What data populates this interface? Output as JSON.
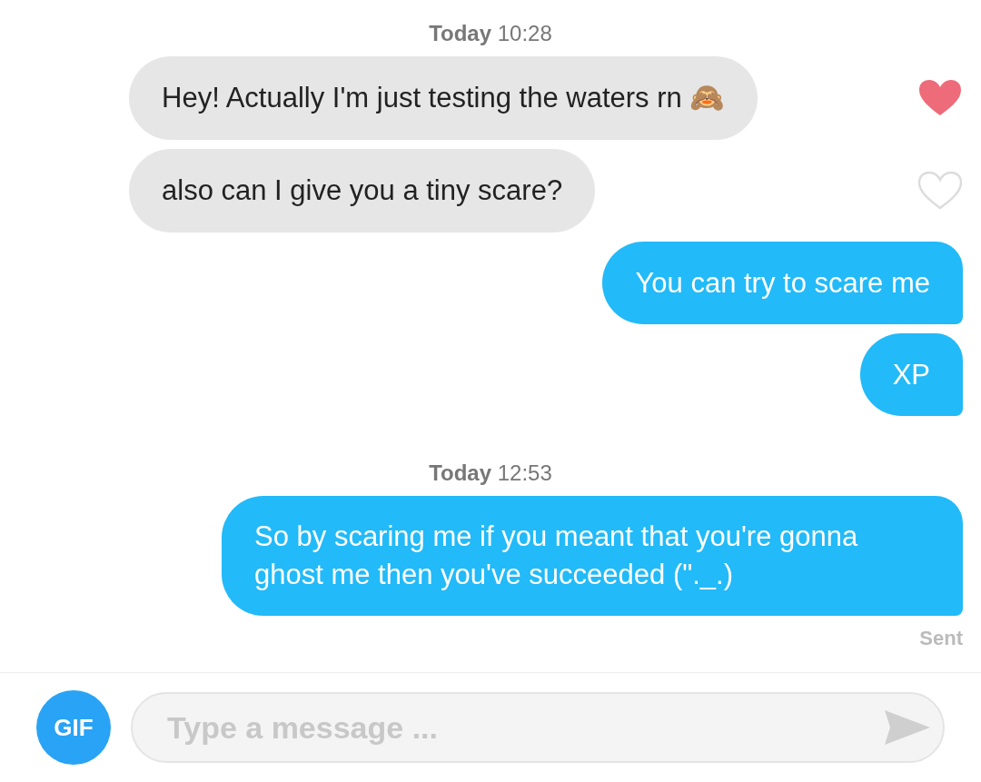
{
  "messages": [
    {
      "kind": "timestamp",
      "day": "Today",
      "time": "10:28"
    },
    {
      "kind": "received",
      "text": "Hey! Actually I'm just testing the waters rn 🙈",
      "liked": true
    },
    {
      "kind": "received",
      "text": "also can I give you a tiny scare?",
      "liked": false
    },
    {
      "kind": "sent",
      "text": "You can try to scare me"
    },
    {
      "kind": "sent",
      "text": "XP"
    },
    {
      "kind": "gap"
    },
    {
      "kind": "timestamp",
      "day": "Today",
      "time": "12:53"
    },
    {
      "kind": "sent",
      "text": "So by scaring me if you meant that you're gonna ghost me then you've succeeded (\"._.)"
    }
  ],
  "status": "Sent",
  "composer": {
    "gif_label": "GIF",
    "placeholder": "Type a message ..."
  }
}
